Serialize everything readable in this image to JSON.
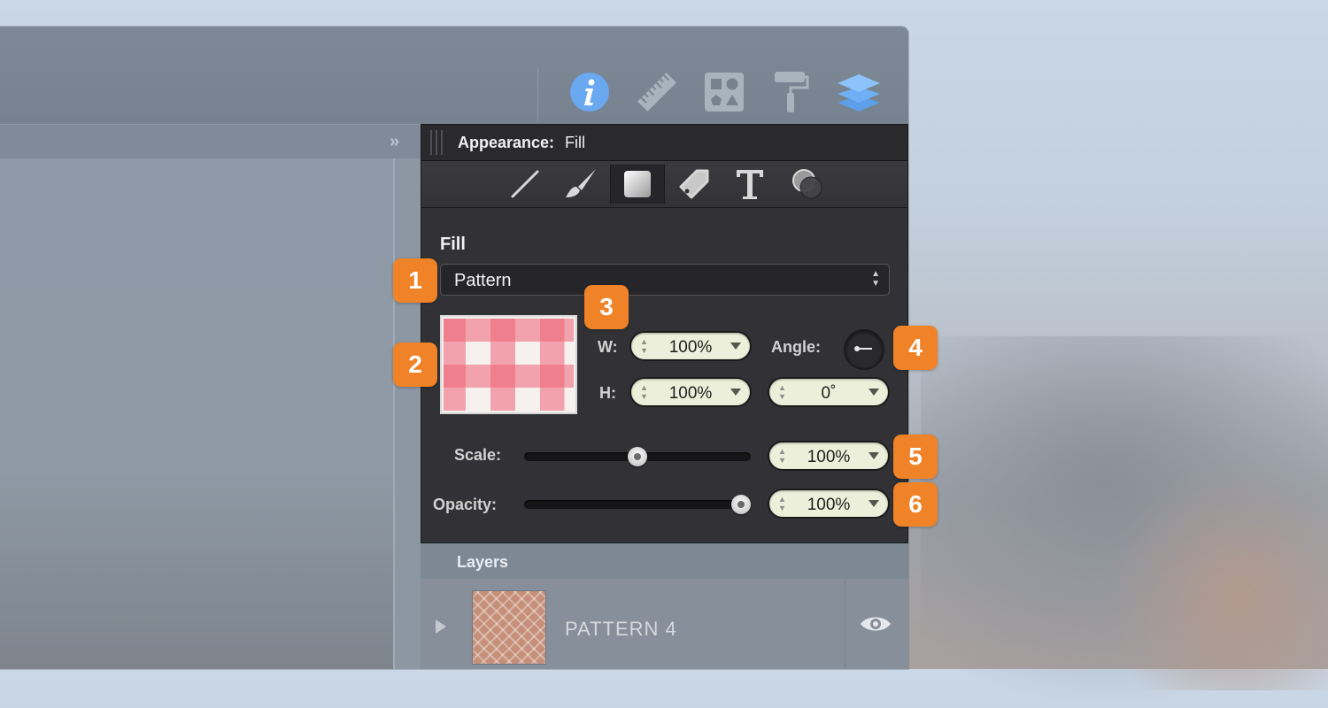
{
  "toolbar": {
    "icons": [
      "info-icon",
      "ruler-icon",
      "shapes-icon",
      "paint-roller-icon",
      "layers-icon"
    ],
    "collapse_glyph": "»"
  },
  "panel": {
    "title_label": "Appearance:",
    "title_value": "Fill",
    "tools": [
      "stroke-tool",
      "brush-tool",
      "fill-tool",
      "tag-tool",
      "text-tool",
      "shadow-tool"
    ],
    "active_tool": "fill-tool"
  },
  "fill": {
    "section_label": "Fill",
    "type_select": {
      "value": "Pattern"
    },
    "width": {
      "label": "W:",
      "value": "100%"
    },
    "height": {
      "label": "H:",
      "value": "100%"
    },
    "angle": {
      "label": "Angle:",
      "value": "0˚"
    },
    "scale": {
      "label": "Scale:",
      "value": "100%",
      "slider_fraction": 0.5
    },
    "opacity": {
      "label": "Opacity:",
      "value": "100%",
      "slider_fraction": 1.0
    }
  },
  "layers": {
    "title": "Layers",
    "rows": [
      {
        "name": "PATTERN 4"
      }
    ]
  },
  "callouts": [
    "1",
    "2",
    "3",
    "4",
    "5",
    "6"
  ],
  "colors": {
    "callout": "#f08227",
    "panel_bg": "#323236",
    "stepper_bg": "#ecefd9",
    "info_icon": "#6aa8f0",
    "layers_icon": "#6fb0f5"
  }
}
